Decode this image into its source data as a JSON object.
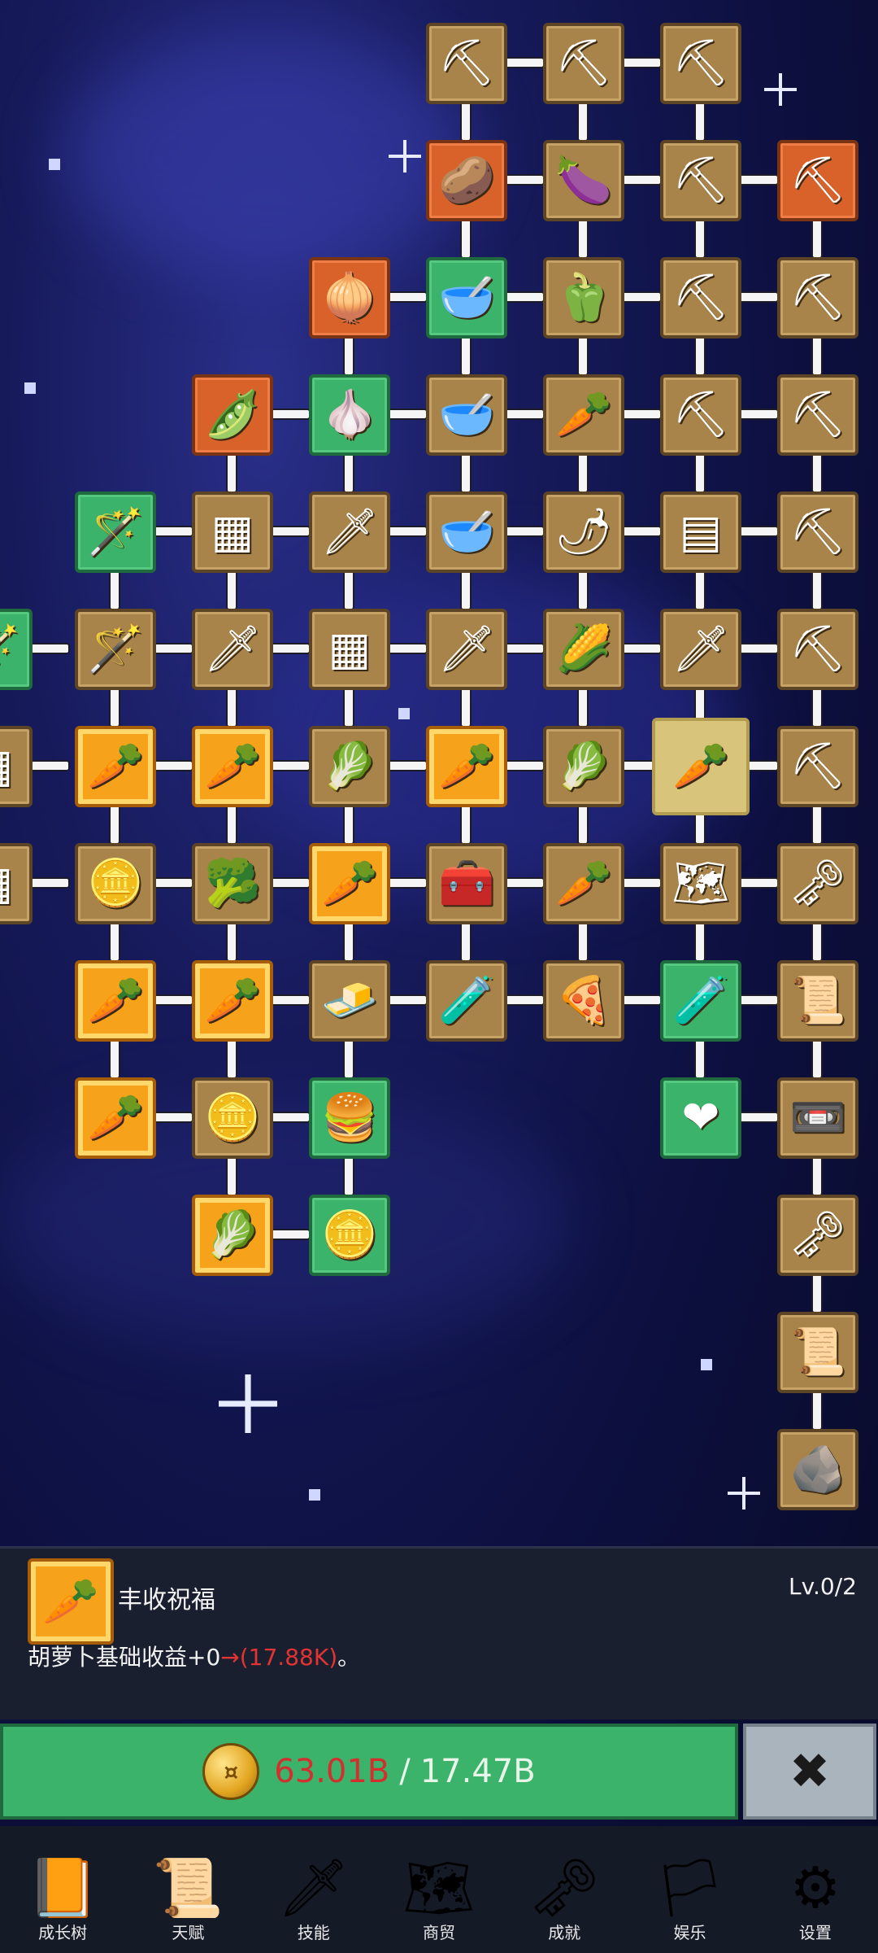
{
  "info": {
    "title": "丰收祝福",
    "level": "Lv.0/2",
    "desc_prefix": "胡萝卜基础收益+0",
    "desc_arrow": "→",
    "desc_value": "(17.88K)",
    "desc_suffix": "。"
  },
  "buy": {
    "current": "63.01B",
    "separator": "/",
    "required": "17.47B",
    "close_label": "✖"
  },
  "nav": [
    {
      "label": "成长树",
      "icon": "book-icon"
    },
    {
      "label": "天赋",
      "icon": "scroll-icon"
    },
    {
      "label": "技能",
      "icon": "sword-icon"
    },
    {
      "label": "商贸",
      "icon": "map-icon"
    },
    {
      "label": "成就",
      "icon": "key-icon"
    },
    {
      "label": "娱乐",
      "icon": "banner-icon"
    },
    {
      "label": "设置",
      "icon": "gear-icon"
    }
  ],
  "tree_nodes": [
    {
      "icon": "shovel-icon",
      "kind": "brown"
    },
    {
      "icon": "shovel-icon",
      "kind": "brown"
    },
    {
      "icon": "shovel-icon",
      "kind": "brown"
    },
    {
      "icon": "potato-icon",
      "kind": "orange"
    },
    {
      "icon": "eggplant-icon",
      "kind": "brown"
    },
    {
      "icon": "shovel-icon",
      "kind": "brown"
    },
    {
      "icon": "pickaxe-icon",
      "kind": "orange"
    },
    {
      "icon": "onion-icon",
      "kind": "orange"
    },
    {
      "icon": "bowl-icon",
      "kind": "green"
    },
    {
      "icon": "pepper-icon",
      "kind": "brown"
    },
    {
      "icon": "shovel-icon",
      "kind": "brown"
    },
    {
      "icon": "pickaxe-icon",
      "kind": "brown"
    },
    {
      "icon": "peas-icon",
      "kind": "orange"
    },
    {
      "icon": "garlic-icon",
      "kind": "green"
    },
    {
      "icon": "bowl-icon",
      "kind": "brown"
    },
    {
      "icon": "radish-icon",
      "kind": "brown"
    },
    {
      "icon": "shovel-icon",
      "kind": "brown"
    },
    {
      "icon": "pickaxe-icon",
      "kind": "brown"
    },
    {
      "icon": "staff-icon",
      "kind": "green"
    },
    {
      "icon": "crate-icon",
      "kind": "brown"
    },
    {
      "icon": "sword-icon",
      "kind": "brown"
    },
    {
      "icon": "bowl-icon",
      "kind": "brown"
    },
    {
      "icon": "chili-icon",
      "kind": "brown"
    },
    {
      "icon": "sack-icon",
      "kind": "brown"
    },
    {
      "icon": "pickaxe-icon",
      "kind": "brown"
    },
    {
      "icon": "wand-icon",
      "kind": "green"
    },
    {
      "icon": "wand-icon",
      "kind": "brown"
    },
    {
      "icon": "sword-icon",
      "kind": "brown"
    },
    {
      "icon": "crate-icon",
      "kind": "brown"
    },
    {
      "icon": "sword-icon",
      "kind": "brown"
    },
    {
      "icon": "corn-icon",
      "kind": "brown"
    },
    {
      "icon": "dagger-icon",
      "kind": "brown"
    },
    {
      "icon": "pickaxe-icon",
      "kind": "brown"
    },
    {
      "icon": "crate-icon",
      "kind": "brown"
    },
    {
      "icon": "carrot-icon",
      "kind": "gold"
    },
    {
      "icon": "carrot-icon",
      "kind": "gold"
    },
    {
      "icon": "cabbage-icon",
      "kind": "brown"
    },
    {
      "icon": "carrot-icon",
      "kind": "gold"
    },
    {
      "icon": "cabbage-icon",
      "kind": "brown"
    },
    {
      "icon": "carrot-icon",
      "kind": "selected"
    },
    {
      "icon": "pickaxe-icon",
      "kind": "brown"
    },
    {
      "icon": "crate-icon",
      "kind": "brown"
    },
    {
      "icon": "coin-icon",
      "kind": "brown"
    },
    {
      "icon": "broccoli-icon",
      "kind": "brown"
    },
    {
      "icon": "carrot-icon",
      "kind": "gold"
    },
    {
      "icon": "chest-icon",
      "kind": "brown"
    },
    {
      "icon": "parsnip-icon",
      "kind": "brown"
    },
    {
      "icon": "map-icon",
      "kind": "brown"
    },
    {
      "icon": "key-icon",
      "kind": "brown"
    },
    {
      "icon": "carrot-icon",
      "kind": "gold"
    },
    {
      "icon": "carrot-icon",
      "kind": "gold"
    },
    {
      "icon": "butter-icon",
      "kind": "brown"
    },
    {
      "icon": "potion-icon",
      "kind": "brown"
    },
    {
      "icon": "pizza-icon",
      "kind": "brown"
    },
    {
      "icon": "potion-icon",
      "kind": "green"
    },
    {
      "icon": "scroll-icon",
      "kind": "brown"
    },
    {
      "icon": "carrot-icon",
      "kind": "gold"
    },
    {
      "icon": "coin-icon",
      "kind": "brown"
    },
    {
      "icon": "burger-icon",
      "kind": "green"
    },
    {
      "icon": "heart-icon",
      "kind": "green"
    },
    {
      "icon": "cassette-icon",
      "kind": "brown"
    },
    {
      "icon": "cabbage-icon",
      "kind": "gold"
    },
    {
      "icon": "coin-icon",
      "kind": "green"
    },
    {
      "icon": "key-icon",
      "kind": "brown"
    },
    {
      "icon": "scroll-icon",
      "kind": "brown"
    },
    {
      "icon": "rock-icon",
      "kind": "brown"
    }
  ]
}
